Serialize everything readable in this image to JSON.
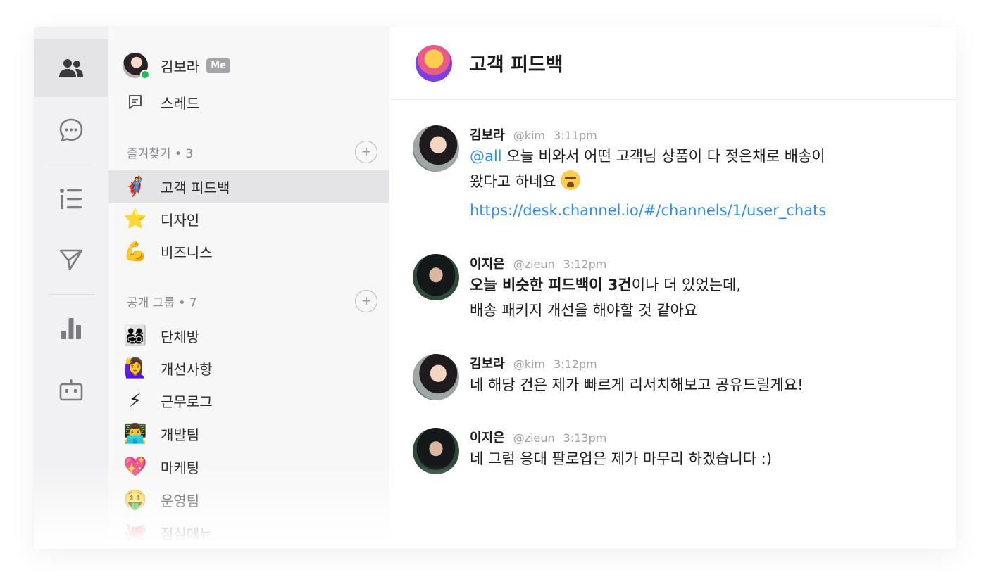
{
  "rail": {
    "items": [
      {
        "icon": "people-icon",
        "active": true
      },
      {
        "icon": "chat-bubble-icon",
        "active": false
      },
      {
        "icon": "list-icon",
        "active": false
      },
      {
        "icon": "send-icon",
        "active": false
      },
      {
        "icon": "bar-chart-icon",
        "active": false
      },
      {
        "icon": "bot-icon",
        "active": false
      }
    ]
  },
  "sidebar": {
    "me": {
      "name": "김보라",
      "badge": "Me",
      "status_color": "#19c15a"
    },
    "threads_label": "스레드",
    "favorites": {
      "title": "즐겨찾기 • 3",
      "items": [
        {
          "emoji": "🦸‍♀️",
          "label": "고객 피드백",
          "active": true
        },
        {
          "emoji": "⭐",
          "label": "디자인",
          "active": false
        },
        {
          "emoji": "💪",
          "label": "비즈니스",
          "active": false
        }
      ]
    },
    "public_groups": {
      "title": "공개 그룹 • 7",
      "items": [
        {
          "emoji": "👨‍👩‍👧‍👦",
          "label": "단체방"
        },
        {
          "emoji": "🙋‍♀️",
          "label": "개선사항"
        },
        {
          "emoji": "⚡",
          "label": "근무로그"
        },
        {
          "emoji": "👨‍💻",
          "label": "개발팀"
        },
        {
          "emoji": "💖",
          "label": "마케팅"
        },
        {
          "emoji": "🤑",
          "label": "운영팀"
        },
        {
          "emoji": "🐙",
          "label": "점심메뉴"
        }
      ]
    }
  },
  "chat": {
    "title": "고객 피드백",
    "messages": [
      {
        "name": "김보라",
        "handle": "@kim",
        "time": "3:11pm",
        "mention": "@all",
        "text_line1": " 오늘 비와서 어떤 고객님 상품이 다 젖은채로 배송이",
        "text_line2": "왔다고 하네요 ",
        "link": "https://desk.channel.io/#/channels/1/user_chats"
      },
      {
        "name": "이지은",
        "handle": "@zieun",
        "time": "3:12pm",
        "bold_part": "오늘 비슷한 피드백이 3건",
        "text_line1_rest": "이나 더 있었는데,",
        "text_line2": "배송 패키지 개선을 해야할 것 같아요"
      },
      {
        "name": "김보라",
        "handle": "@kim",
        "time": "3:12pm",
        "text": "네 해당 건은 제가 빠르게 리서치해보고 공유드릴게요!"
      },
      {
        "name": "이지은",
        "handle": "@zieun",
        "time": "3:13pm",
        "text": "네 그럼 응대 팔로업은 제가 마무리 하겠습니다 :)"
      }
    ]
  },
  "colors": {
    "accent": "#2a8ff1",
    "online": "#19c15a",
    "active_row": "#e4e4e7"
  }
}
